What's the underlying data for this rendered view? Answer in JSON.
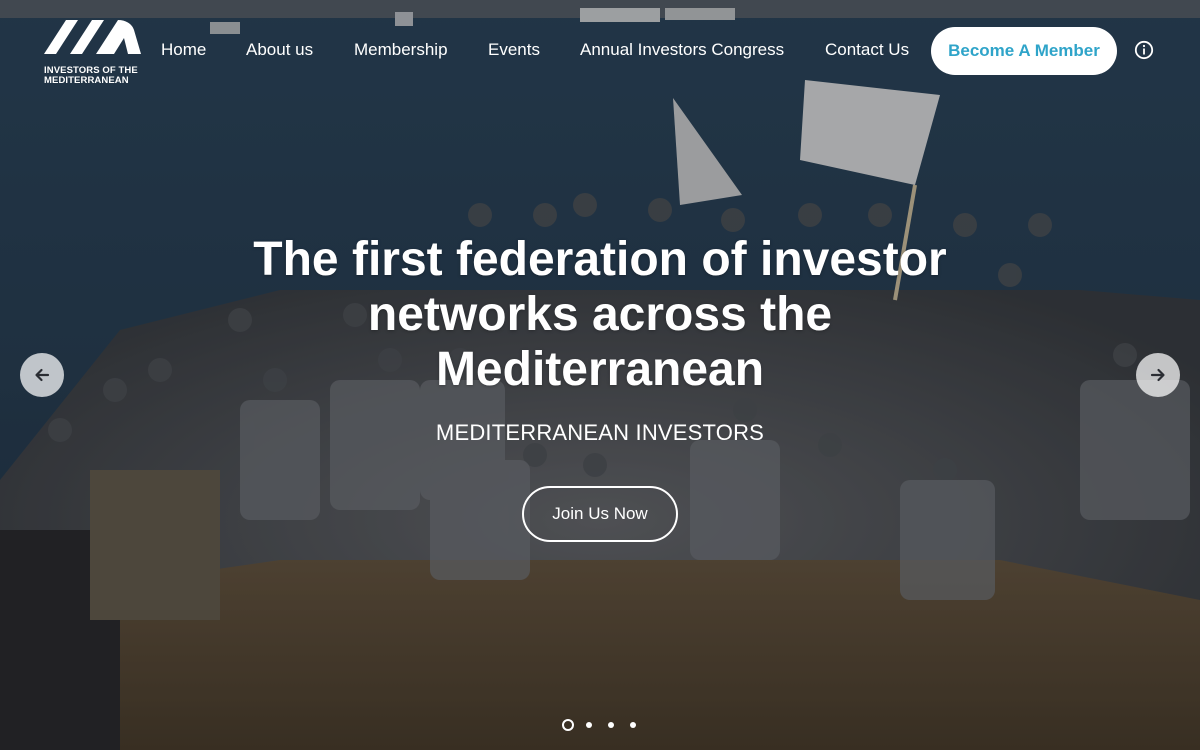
{
  "brand": {
    "logo_line1": "INVESTORS OF THE",
    "logo_line2": "MEDITERRANEAN"
  },
  "nav": {
    "items": [
      {
        "label": "Home"
      },
      {
        "label": "About us"
      },
      {
        "label": "Membership"
      },
      {
        "label": "Events"
      },
      {
        "label": "Annual Investors Congress"
      },
      {
        "label": "Contact Us"
      }
    ],
    "cta_label": "Become A Member",
    "info_icon": "info-circle-icon"
  },
  "hero": {
    "title": "The first federation of investor networks across the Mediterranean",
    "subtitle": "MEDITERRANEAN INVESTORS",
    "button_label": "Join Us Now",
    "prev_icon": "arrow-left-icon",
    "next_icon": "arrow-right-icon",
    "slides_total": 4,
    "slide_active": 1
  },
  "colors": {
    "accent": "#2fa4c9",
    "button_bg": "#ffffff",
    "text": "#ffffff"
  }
}
